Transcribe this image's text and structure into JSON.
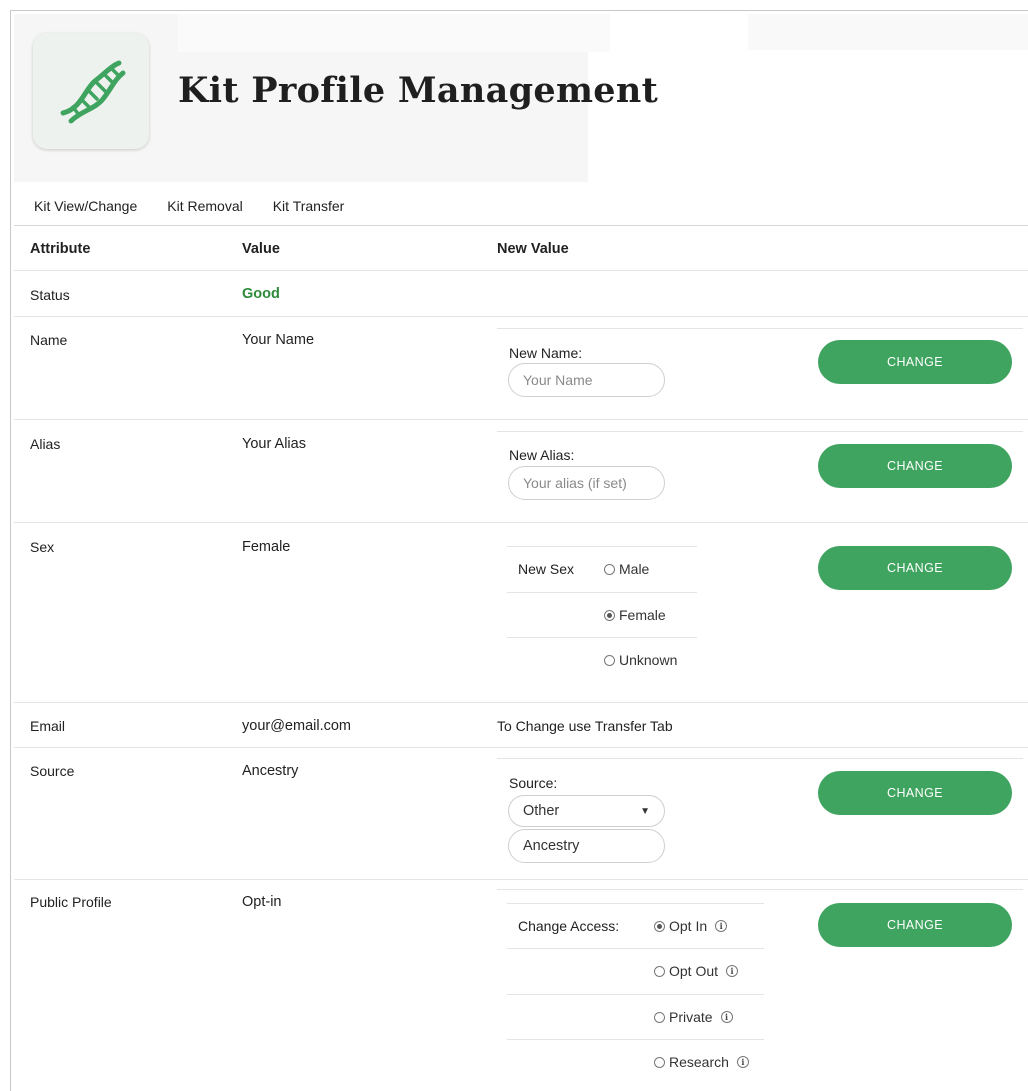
{
  "header": {
    "title": "Kit Profile Management"
  },
  "tabs": [
    "Kit View/Change",
    "Kit Removal",
    "Kit Transfer"
  ],
  "table": {
    "headers": {
      "attribute": "Attribute",
      "value": "Value",
      "new_value": "New Value"
    }
  },
  "rows": {
    "status": {
      "attribute": "Status",
      "value": "Good"
    },
    "name": {
      "attribute": "Name",
      "value": "Your Name",
      "label": "New Name:",
      "placeholder": "Your Name",
      "button": "CHANGE"
    },
    "alias": {
      "attribute": "Alias",
      "value": "Your Alias",
      "label": "New Alias:",
      "placeholder": "Your alias (if set)",
      "button": "CHANGE"
    },
    "sex": {
      "attribute": "Sex",
      "value": "Female",
      "label": "New Sex",
      "options": [
        {
          "label": "Male",
          "selected": false
        },
        {
          "label": "Female",
          "selected": true
        },
        {
          "label": "Unknown",
          "selected": false
        }
      ],
      "button": "CHANGE"
    },
    "email": {
      "attribute": "Email",
      "value": "your@email.com",
      "note": "To Change use Transfer Tab"
    },
    "source": {
      "attribute": "Source",
      "value": "Ancestry",
      "label": "Source:",
      "select_value": "Other",
      "input_value": "Ancestry",
      "button": "CHANGE"
    },
    "public_profile": {
      "attribute": "Public Profile",
      "value": "Opt-in",
      "label": "Change Access:",
      "options": [
        {
          "label": "Opt In",
          "selected": true
        },
        {
          "label": "Opt Out",
          "selected": false
        },
        {
          "label": "Private",
          "selected": false
        },
        {
          "label": "Research",
          "selected": false
        }
      ],
      "button": "CHANGE"
    }
  },
  "colors": {
    "accent": "#3fa45f",
    "good": "#2e8b3b"
  },
  "icons": {
    "logo": "dna-icon",
    "info": "info-icon",
    "chevron": "chevron-down-icon"
  }
}
